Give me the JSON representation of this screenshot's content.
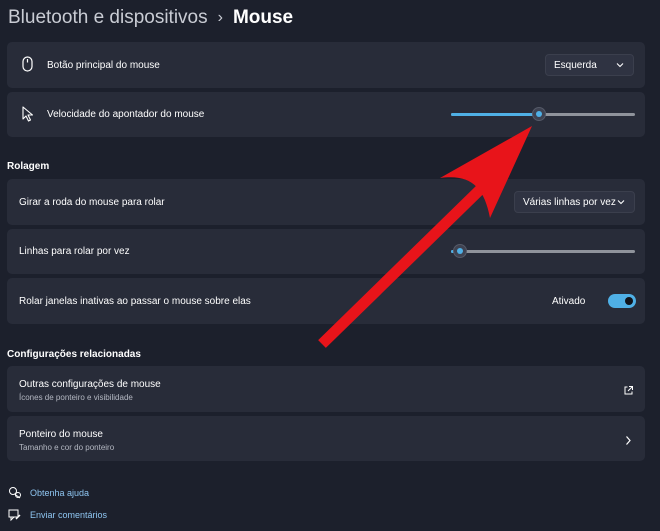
{
  "breadcrumb": {
    "parent": "Bluetooth e dispositivos",
    "separator": "›",
    "current": "Mouse"
  },
  "settings": {
    "primary_button": {
      "label": "Botão principal do mouse",
      "value": "Esquerda",
      "icon": "mouse-icon"
    },
    "pointer_speed": {
      "label": "Velocidade do apontador do mouse",
      "level": 0.48,
      "icon": "pointer-icon"
    }
  },
  "scrolling": {
    "title": "Rolagem",
    "wheel_scroll": {
      "label": "Girar a roda do mouse para rolar",
      "value": "Várias linhas por vez"
    },
    "lines_per_scroll": {
      "label": "Linhas para rolar por vez",
      "level": 0.05
    },
    "inactive_windows": {
      "label": "Rolar janelas inativas ao passar o mouse sobre elas",
      "state": "Ativado",
      "on": true
    }
  },
  "related": {
    "title": "Configurações relacionadas",
    "items": [
      {
        "title": "Outras configurações de mouse",
        "subtitle": "Ícones de ponteiro e visibilidade",
        "icon": "external-link-icon"
      },
      {
        "title": "Ponteiro do mouse",
        "subtitle": "Tamanho e cor do ponteiro",
        "icon": "chevron-right-icon"
      }
    ]
  },
  "footer": {
    "help": "Obtenha ajuda",
    "feedback": "Enviar comentários"
  },
  "colors": {
    "accent": "#4fb0e6",
    "annotation_arrow": "#e8141a",
    "background": "#1c202c",
    "card": "#282c39"
  }
}
